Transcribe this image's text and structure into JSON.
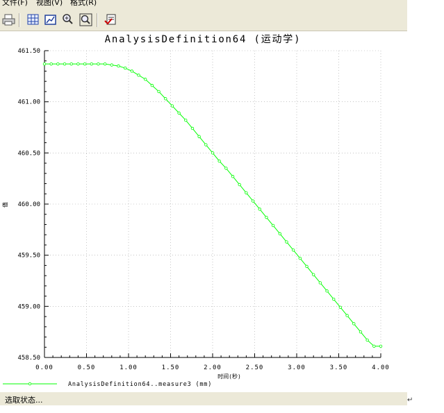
{
  "menu": {
    "items": [
      "文件(F)",
      "视图(V)",
      "格式(R)"
    ]
  },
  "toolbar": {
    "icons": [
      "print-icon",
      "grid-icon",
      "chart-format-icon",
      "zoom-in-icon",
      "zoom-window-icon",
      "export-icon"
    ]
  },
  "status": {
    "text": "选取状态..."
  },
  "colors": {
    "series": "#00ff00",
    "grid": "#a0a0a0",
    "chrome": "#ece9d8"
  },
  "chart_data": {
    "type": "line",
    "title": "AnalysisDefinition64 (运动学)",
    "xlabel": "时间(秒)",
    "ylabel": "值",
    "xlim": [
      0,
      4
    ],
    "ylim": [
      458.5,
      461.5
    ],
    "x_ticks": [
      "0.00",
      "0.50",
      "1.00",
      "1.50",
      "2.00",
      "2.50",
      "3.00",
      "3.50",
      "4.00"
    ],
    "y_ticks": [
      "461.50",
      "461.00",
      "460.50",
      "460.00",
      "459.50",
      "459.00",
      "458.50"
    ],
    "grid": true,
    "legend_position": "bottom-left",
    "series": [
      {
        "name": "AnalysisDefinition64..measure3 (mm)",
        "color": "#00ff00",
        "x": [
          0.0,
          0.08,
          0.16,
          0.24,
          0.32,
          0.4,
          0.48,
          0.56,
          0.64,
          0.72,
          0.8,
          0.88,
          0.96,
          1.04,
          1.12,
          1.2,
          1.28,
          1.36,
          1.44,
          1.52,
          1.6,
          1.68,
          1.76,
          1.84,
          1.92,
          2.0,
          2.08,
          2.16,
          2.24,
          2.32,
          2.4,
          2.48,
          2.56,
          2.64,
          2.72,
          2.8,
          2.88,
          2.96,
          3.04,
          3.12,
          3.2,
          3.28,
          3.36,
          3.44,
          3.52,
          3.6,
          3.68,
          3.76,
          3.84,
          3.92,
          4.0
        ],
        "y": [
          461.37,
          461.37,
          461.37,
          461.37,
          461.37,
          461.37,
          461.37,
          461.37,
          461.37,
          461.37,
          461.36,
          461.35,
          461.33,
          461.3,
          461.26,
          461.22,
          461.16,
          461.1,
          461.03,
          460.96,
          460.89,
          460.82,
          460.74,
          460.66,
          460.58,
          460.5,
          460.42,
          460.35,
          460.27,
          460.19,
          460.11,
          460.03,
          459.95,
          459.87,
          459.79,
          459.71,
          459.63,
          459.55,
          459.47,
          459.39,
          459.31,
          459.23,
          459.15,
          459.07,
          458.99,
          458.91,
          458.83,
          458.75,
          458.67,
          458.61,
          458.61
        ]
      }
    ]
  }
}
